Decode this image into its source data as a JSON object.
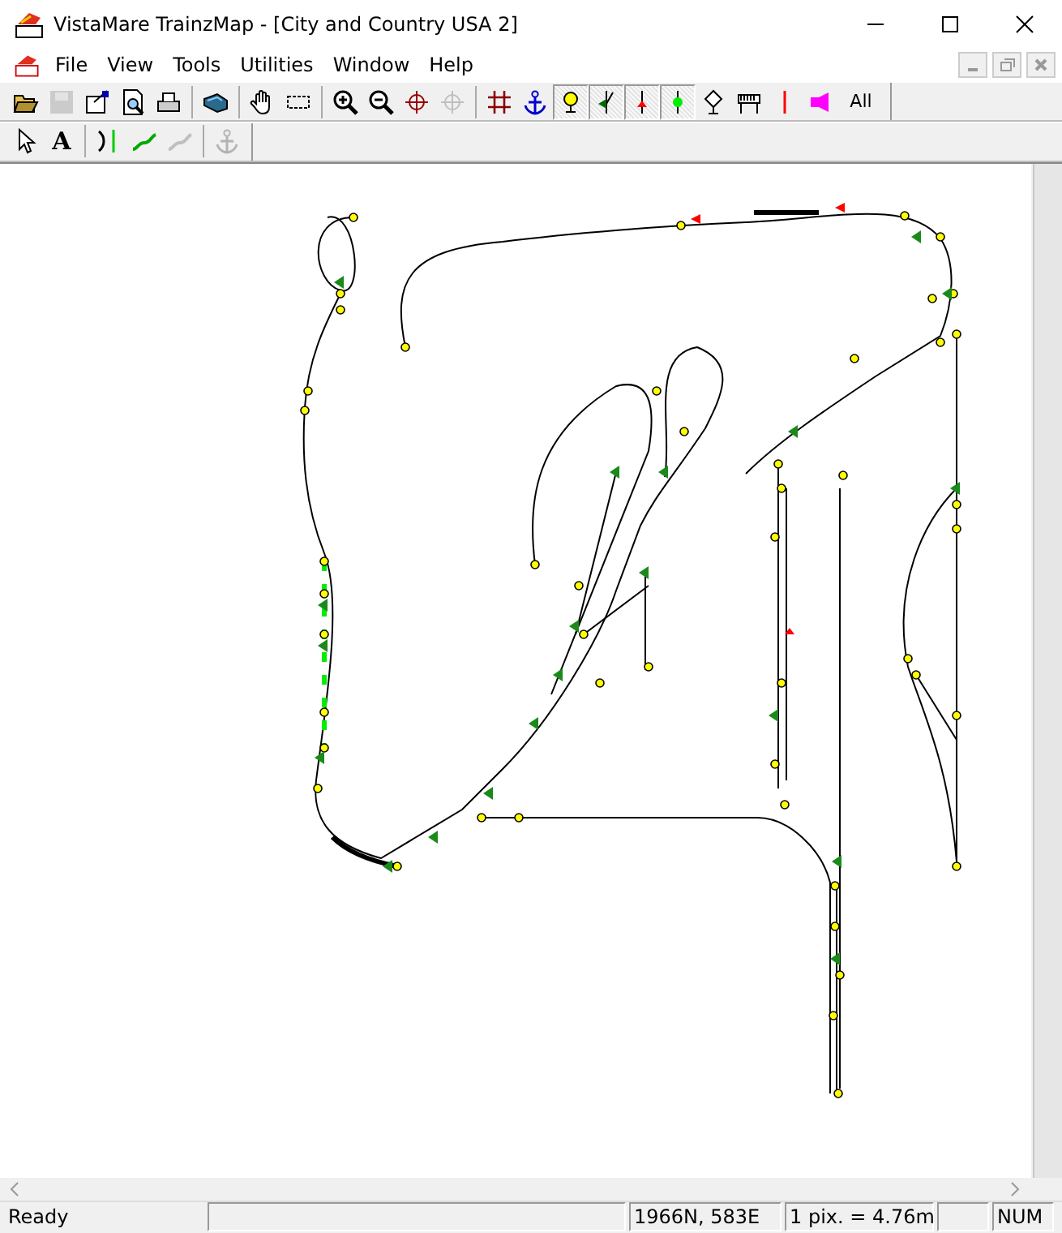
{
  "window": {
    "title": "VistaMare TrainzMap - [City and Country USA 2]"
  },
  "menu": [
    {
      "label": "File"
    },
    {
      "label": "View"
    },
    {
      "label": "Tools"
    },
    {
      "label": "Utilities"
    },
    {
      "label": "Window"
    },
    {
      "label": "Help"
    }
  ],
  "toolbar": [
    {
      "kind": "open",
      "disabled": false,
      "pressed": false
    },
    {
      "kind": "save",
      "disabled": true,
      "pressed": false
    },
    {
      "kind": "properties",
      "disabled": false,
      "pressed": false
    },
    {
      "kind": "preview",
      "disabled": false,
      "pressed": false
    },
    {
      "kind": "print",
      "disabled": false,
      "pressed": false
    },
    {
      "kind": "sep"
    },
    {
      "kind": "train",
      "disabled": false,
      "pressed": false
    },
    {
      "kind": "sep"
    },
    {
      "kind": "hand",
      "disabled": false,
      "pressed": false
    },
    {
      "kind": "rect",
      "disabled": false,
      "pressed": false
    },
    {
      "kind": "sep"
    },
    {
      "kind": "zoomin",
      "disabled": false,
      "pressed": false
    },
    {
      "kind": "zoomout",
      "disabled": false,
      "pressed": false
    },
    {
      "kind": "center",
      "disabled": false,
      "pressed": false
    },
    {
      "kind": "center",
      "disabled": true,
      "pressed": false
    },
    {
      "kind": "sep"
    },
    {
      "kind": "grid",
      "disabled": false,
      "pressed": false
    },
    {
      "kind": "anchor",
      "disabled": false,
      "pressed": false
    },
    {
      "kind": "signal",
      "disabled": false,
      "pressed": true
    },
    {
      "kind": "junction",
      "disabled": false,
      "pressed": true
    },
    {
      "kind": "redmark",
      "disabled": false,
      "pressed": true
    },
    {
      "kind": "greenmark",
      "disabled": false,
      "pressed": true
    },
    {
      "kind": "trackmark",
      "disabled": false,
      "pressed": false
    },
    {
      "kind": "station",
      "disabled": false,
      "pressed": false
    },
    {
      "kind": "redline",
      "disabled": false,
      "pressed": false
    },
    {
      "kind": "horn",
      "disabled": false,
      "pressed": false
    },
    {
      "kind": "text",
      "label": "All",
      "pressed": false
    }
  ],
  "toolbar2": [
    {
      "kind": "pointer",
      "disabled": false
    },
    {
      "kind": "textA",
      "label": "A"
    },
    {
      "kind": "sep"
    },
    {
      "kind": "spline",
      "disabled": false
    },
    {
      "kind": "curve",
      "disabled": false
    },
    {
      "kind": "curve",
      "disabled": true
    },
    {
      "kind": "sep"
    },
    {
      "kind": "anchor",
      "disabled": true
    }
  ],
  "status_bar": {
    "message": "Ready",
    "coordinates": "1966N, 583E",
    "scale": "1 pix. = 4.76m",
    "num": "NUM"
  }
}
